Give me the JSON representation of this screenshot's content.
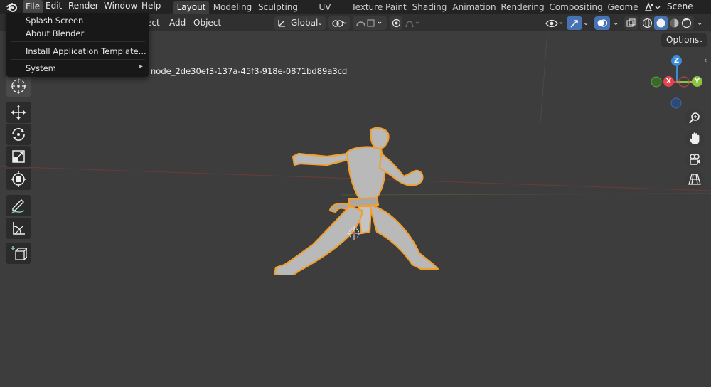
{
  "menubar": {
    "items": [
      "File",
      "Edit",
      "Render",
      "Window",
      "Help"
    ]
  },
  "workspaces": {
    "tabs": [
      "Layout",
      "Modeling",
      "Sculpting",
      "UV Editing",
      "Texture Paint",
      "Shading",
      "Animation",
      "Rendering",
      "Compositing",
      "Geome"
    ],
    "active": "Layout"
  },
  "scene": {
    "name": "Scene"
  },
  "header": {
    "menus": [
      "ect",
      "Add",
      "Object"
    ],
    "transform_orientation": "Global",
    "options_label": "Options"
  },
  "viewport": {
    "object_name": "node_2de30ef3-137a-45f3-918e-0871bd89a3cd"
  },
  "file_menu": {
    "items": [
      "Splash Screen",
      "About Blender",
      "Install Application Template...",
      "System"
    ],
    "submenu_arrow": "▸"
  },
  "gizmo": {
    "x": "X",
    "y": "Y",
    "z": "Z"
  },
  "colors": {
    "accent_blue": "#4772b3",
    "selection_outline": "#f0a030",
    "axis_x": "#e8434e",
    "axis_y": "#8bc53f",
    "axis_z": "#3b8bd8"
  },
  "icons": {
    "blender_logo": "blender-icon",
    "cursor_tool": "cursor-icon",
    "move_tool": "move-icon",
    "rotate_tool": "rotate-icon",
    "scale_tool": "scale-icon",
    "transform_tool": "transform-icon",
    "annotate_tool": "annotate-icon",
    "measure_tool": "measure-icon",
    "add_cube_tool": "add-cube-icon",
    "zoom": "zoom-icon",
    "pan": "hand-icon",
    "camera": "camera-icon",
    "perspective": "grid-icon"
  }
}
